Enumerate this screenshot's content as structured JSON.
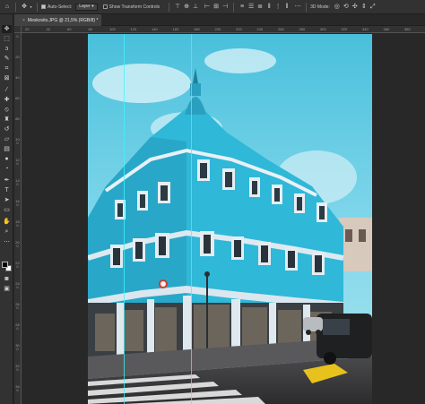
{
  "options_bar": {
    "auto_select_label": "Auto-Select:",
    "auto_select_checked": true,
    "layer_select_value": "Layer",
    "show_transform_label": "Show Transform Controls",
    "show_transform_checked": false,
    "more_icon": "⋯",
    "mode_3d_label": "3D Mode:"
  },
  "document": {
    "tab_title": "Meskovits.JPG @ 21,5% (RGB/8) *",
    "close_icon": "×"
  },
  "rulers": {
    "top_labels": [
      "20",
      "40",
      "60",
      "80",
      "100",
      "120",
      "140",
      "160",
      "180",
      "200",
      "220",
      "240",
      "260",
      "280",
      "300",
      "320",
      "340",
      "360",
      "380"
    ],
    "left_labels": [
      "0",
      "20",
      "40",
      "60",
      "80",
      "100",
      "120",
      "140",
      "160",
      "180",
      "200",
      "220",
      "240",
      "260",
      "280",
      "300",
      "320",
      "340"
    ]
  },
  "toolbar": {
    "tools": [
      "move-tool",
      "marquee-tool",
      "lasso-tool",
      "quick-select-tool",
      "crop-tool",
      "frame-tool",
      "eyedropper-tool",
      "healing-brush-tool",
      "brush-tool",
      "clone-stamp-tool",
      "history-brush-tool",
      "eraser-tool",
      "gradient-tool",
      "blur-tool",
      "dodge-tool",
      "pen-tool",
      "type-tool",
      "path-select-tool",
      "rectangle-tool",
      "hand-tool",
      "zoom-tool",
      "edit-toolbar"
    ],
    "foreground_color": "#000000",
    "background_color": "#ffffff"
  },
  "colors": {
    "ui_bg": "#282828",
    "panel": "#323232",
    "guide": "#3df5ff",
    "sky": "#4cc3db",
    "facade": "#2fb8d8"
  }
}
